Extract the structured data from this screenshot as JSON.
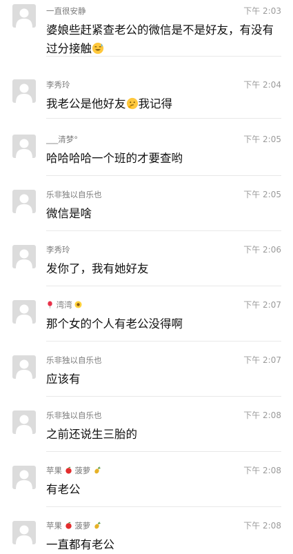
{
  "messages": [
    {
      "name": "一直很安静",
      "time": "下午 2:03",
      "text": "婆娘些赶紧查老公的微信是不是好友，有没有过分接触",
      "text_emoji": "sweat-smile-emoji"
    },
    {
      "name": "李秀玲",
      "time": "下午 2:04",
      "text_before": "我老公是他好友",
      "text_after": "我记得",
      "text_emoji": "thinking-face-emoji"
    },
    {
      "name": "___清梦°",
      "time": "下午 2:05",
      "text": "哈哈哈哈一个班的才要查哟"
    },
    {
      "name": "乐非独以自乐也",
      "time": "下午 2:05",
      "text": "微信是啥"
    },
    {
      "name": "李秀玲",
      "time": "下午 2:06",
      "text": "发你了，我有她好友"
    },
    {
      "name": "湾湾",
      "time": "下午 2:07",
      "text": "那个女的个人有老公没得啊",
      "name_prefix_icon": "balloon-icon",
      "name_suffix_icon": "sunflower-icon"
    },
    {
      "name": "乐非独以自乐也",
      "time": "下午 2:07",
      "text": "应该有"
    },
    {
      "name": "乐非独以自乐也",
      "time": "下午 2:08",
      "text": "之前还说生三胎的"
    },
    {
      "name_a": "苹果",
      "name_b": "菠萝",
      "time": "下午 2:08",
      "text": "有老公",
      "name_icons": [
        "apple-icon",
        "pineapple-icon"
      ]
    },
    {
      "name_a": "苹果",
      "name_b": "菠萝",
      "time": "下午 2:08",
      "text": "一直都有老公",
      "name_icons": [
        "apple-icon",
        "pineapple-icon"
      ]
    }
  ],
  "colors": {
    "avatar_bg": "#dcdcdc",
    "avatar_fg": "#ffffff",
    "name": "#7a7a7a",
    "time": "#9a9a9a",
    "text": "#111111",
    "divider": "#e8e8e8"
  }
}
